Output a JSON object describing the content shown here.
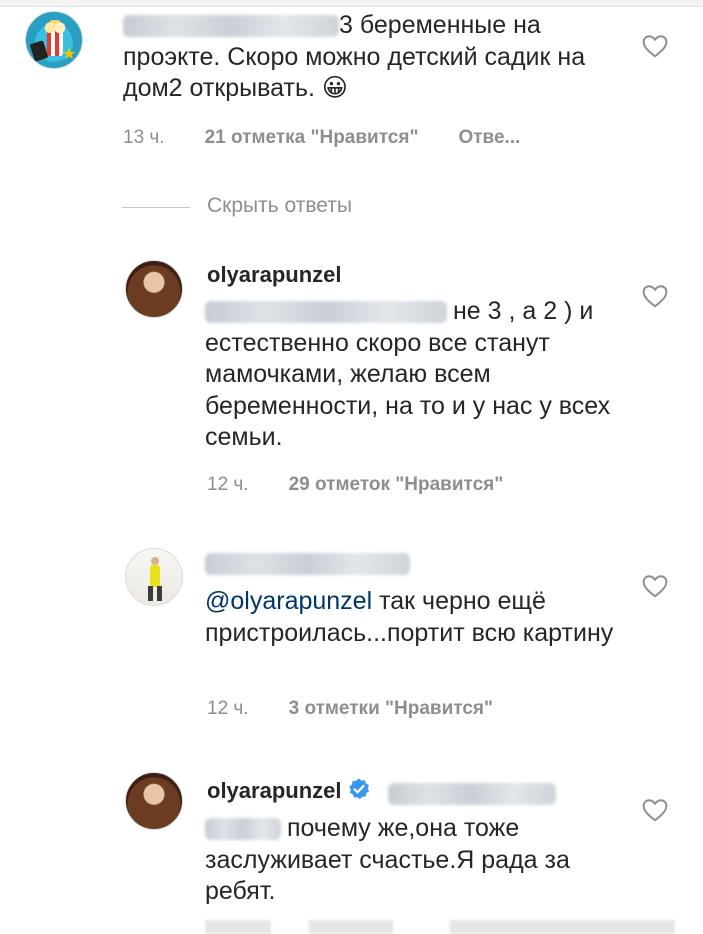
{
  "comments": [
    {
      "text": "3 беременные на проэкте. Скоро можно детский садик на дом2 открывать. 😀",
      "time": "13 ч.",
      "likes": "21 отметка \"Нравится\"",
      "reply": "Отве..."
    },
    {
      "username": "olyarapunzel",
      "text_line1": "не 3 , а 2 ) и",
      "text_rest": "естественно скоро все станут мамочками, желаю всем беременности, на то и у нас у всех семьи.",
      "time": "12 ч.",
      "likes": "29 отметок \"Нравится\""
    },
    {
      "mention": "@olyarapunzel",
      "text": " так черно ещё пристроилась...портит всю картину",
      "time": "12 ч.",
      "likes": "3 отметки \"Нравится\""
    },
    {
      "username": "olyarapunzel",
      "text_line1": "почему же,она тоже",
      "text_rest": "заслуживает счастье.Я рада за ребят."
    }
  ],
  "thread": {
    "hide_replies": "Скрыть ответы"
  },
  "colors": {
    "text": "#262626",
    "secondary": "#8e8e8e",
    "mention": "#003569",
    "verified": "#3897f0"
  },
  "icons": [
    "heart-icon",
    "verified-badge-icon"
  ]
}
